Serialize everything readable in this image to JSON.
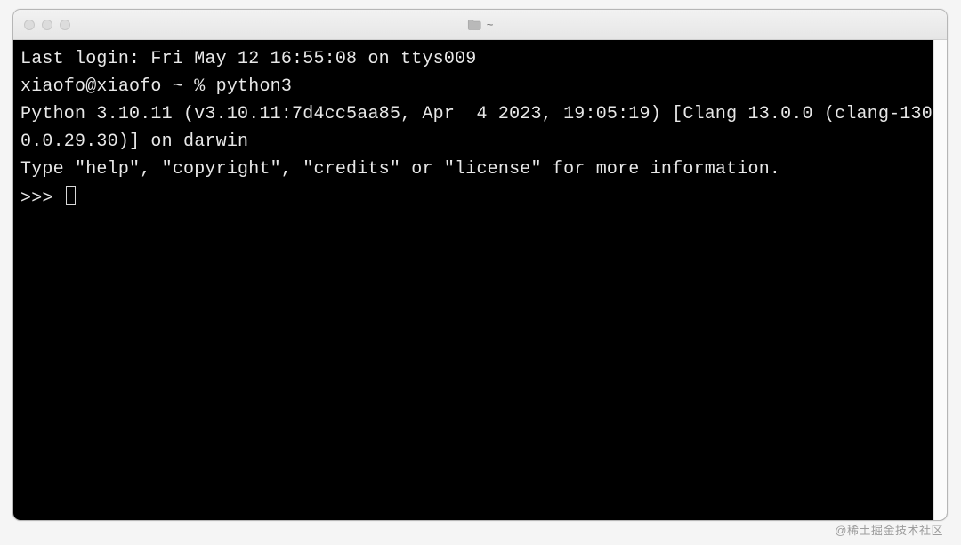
{
  "window": {
    "title": "~"
  },
  "terminal": {
    "last_login": "Last login: Fri May 12 16:55:08 on ttys009",
    "shell_prompt": "xiaofo@xiaofo ~ % ",
    "shell_command": "python3",
    "python_banner_line1": "Python 3.10.11 (v3.10.11:7d4cc5aa85, Apr  4 2023, 19:05:19) [Clang 13.0.0 (clang-1300.0.29.30)] on darwin",
    "python_banner_line2": "Type \"help\", \"copyright\", \"credits\" or \"license\" for more information.",
    "repl_prompt": ">>> "
  },
  "watermark": "@稀土掘金技术社区"
}
